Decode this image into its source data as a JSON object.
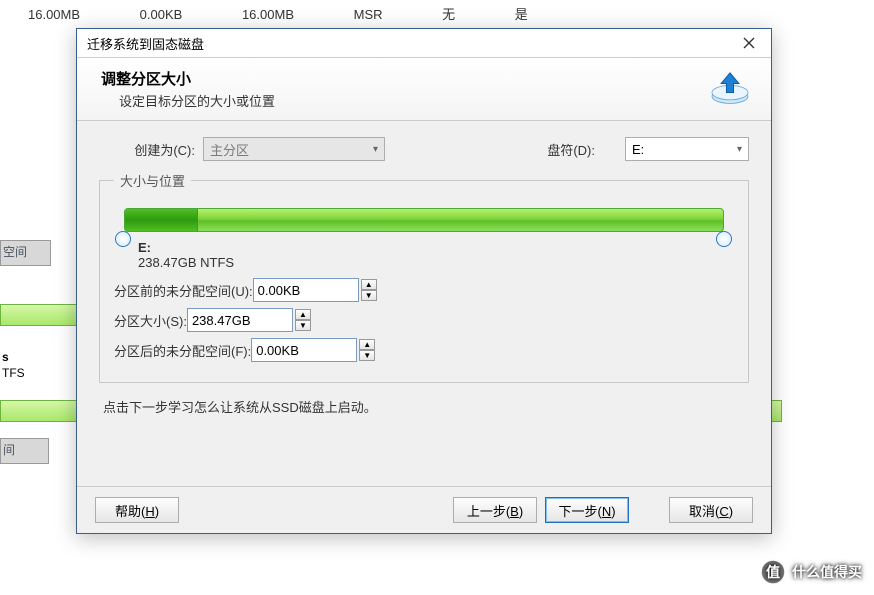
{
  "topRow": {
    "c1": "16.00MB",
    "c2": "0.00KB",
    "c3": "16.00MB",
    "c4": "MSR",
    "c5": "无",
    "c6": "是"
  },
  "bgLabels": {
    "g1": "空间",
    "s": "s",
    "tfs": "TFS",
    "g2": "间"
  },
  "dialog": {
    "title": "迁移系统到固态磁盘",
    "heading": "调整分区大小",
    "subheading": "设定目标分区的大小或位置",
    "createAsLabel": "创建为(C):",
    "createAsValue": "主分区",
    "driveLetterLabel": "盘符(D):",
    "driveLetterValue": "E:",
    "legend": "大小与位置",
    "partition": {
      "letter": "E:",
      "info": "238.47GB NTFS"
    },
    "fields": {
      "beforeLabel": "分区前的未分配空间(U):",
      "beforeValue": "0.00KB",
      "sizeLabel": "分区大小(S):",
      "sizeValue": "238.47GB",
      "afterLabel": "分区后的未分配空间(F):",
      "afterValue": "0.00KB"
    },
    "hint": "点击下一步学习怎么让系统从SSD磁盘上启动。",
    "buttons": {
      "help": "帮助",
      "helpKey": "H",
      "back": "上一步",
      "backKey": "B",
      "next": "下一步",
      "nextKey": "N",
      "cancel": "取消",
      "cancelKey": "C"
    }
  },
  "watermark": "什么值得买"
}
